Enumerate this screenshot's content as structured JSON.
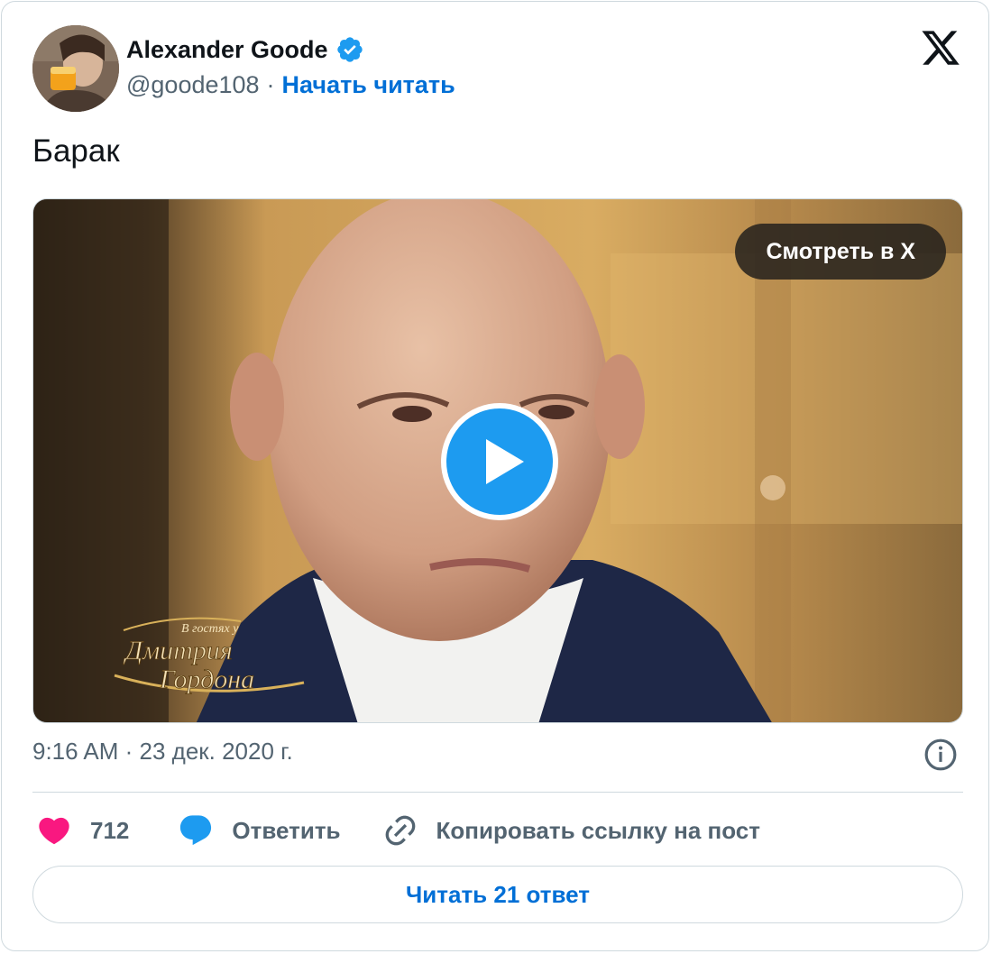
{
  "author": {
    "name": "Alexander Goode",
    "handle": "@goode108",
    "separator": "·",
    "follow_label": "Начать читать"
  },
  "tweet": {
    "text": "Барак",
    "timestamp": "9:16 AM · 23 дек. 2020 г."
  },
  "media": {
    "watch_label": "Смотреть в X",
    "overlay_logo": "В гостях у Дмитрия Гордона"
  },
  "actions": {
    "likes": "712",
    "reply_label": "Ответить",
    "copy_label": "Копировать ссылку на пост"
  },
  "footer": {
    "read_replies_label": "Читать 21 ответ"
  },
  "colors": {
    "accent": "#006fd6",
    "like": "#f91880",
    "reply": "#1d9bf0",
    "play": "#1d9bf0",
    "muted": "#536471"
  }
}
